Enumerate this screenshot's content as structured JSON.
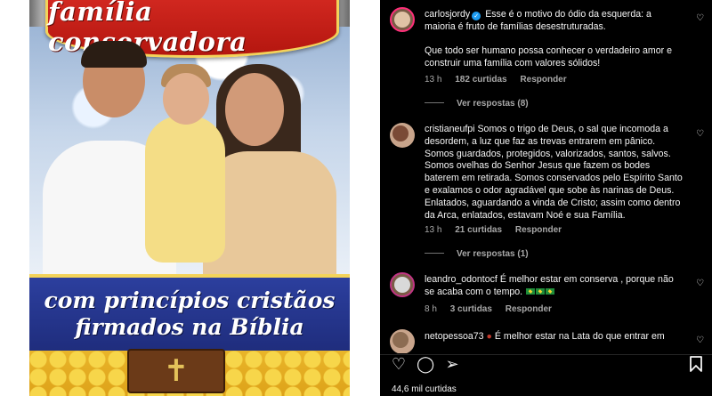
{
  "post_image": {
    "top_banner_text": "família conservadora",
    "bottom_banner_line1": "com princípios cristãos",
    "bottom_banner_line2": "firmados na Bíblia"
  },
  "comments": [
    {
      "username": "carlosjordy",
      "verified": true,
      "text_p1": "Esse é o motivo do ódio da esquerda: a maioria é fruto de famílias desestruturadas.",
      "text_p2": "Que todo ser humano possa conhecer o verdadeiro amor e construir uma família com valores sólidos!",
      "time": "13 h",
      "likes": "182 curtidas",
      "reply": "Responder",
      "view_replies": "Ver respostas (8)"
    },
    {
      "username": "cristianeufpi",
      "text": "Somos o trigo de Deus, o sal que incomoda a desordem, a luz que faz as trevas entrarem em pânico. Somos guardados, protegidos, valorizados, santos, salvos. Somos ovelhas do Senhor Jesus que fazem os bodes baterem em retirada. Somos conservados pelo Espírito Santo e exalamos o odor agradável que sobe às narinas de Deus. Enlatados, aguardando a vinda de Cristo; assim como dentro da Arca, enlatados, estavam Noé e sua Família.",
      "time": "13 h",
      "likes": "21 curtidas",
      "reply": "Responder",
      "view_replies": "Ver respostas (1)"
    },
    {
      "username": "leandro_odontocf",
      "text": "É melhor estar em conserva , porque não se acaba com o tempo.",
      "time": "8 h",
      "likes": "3 curtidas",
      "reply": "Responder"
    },
    {
      "username": "netopessoa73",
      "text": "É melhor estar na Lata do que entrar em"
    }
  ],
  "footer": {
    "likes_count": "44,6 mil curtidas"
  },
  "icons": {
    "heart": "heart-icon",
    "comment": "comment-icon",
    "share": "share-icon",
    "save": "bookmark-icon"
  },
  "colors": {
    "background": "#000000",
    "text": "#f5f5f5",
    "secondary_text": "#a8a8a8",
    "verified": "#1d9bf0"
  }
}
